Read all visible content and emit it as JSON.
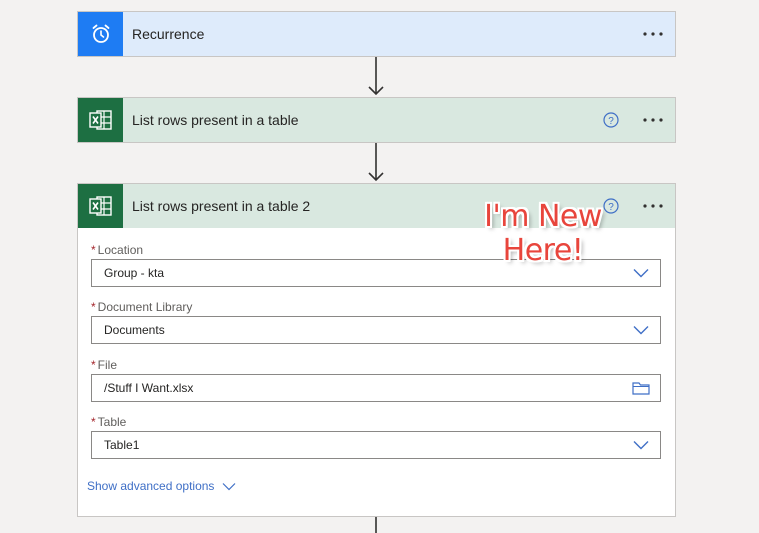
{
  "steps": [
    {
      "title": "Recurrence",
      "icon": "alarm-clock-icon"
    },
    {
      "title": "List rows present in a table",
      "icon": "excel-icon"
    },
    {
      "title": "List rows present in a table 2",
      "icon": "excel-icon"
    }
  ],
  "form": {
    "location": {
      "label": "Location",
      "value": "Group - kta"
    },
    "document_library": {
      "label": "Document Library",
      "value": "Documents"
    },
    "file": {
      "label": "File",
      "value": "/Stuff I Want.xlsx"
    },
    "table": {
      "label": "Table",
      "value": "Table1"
    },
    "required_mark": "*",
    "advanced_label": "Show advanced options"
  },
  "annotation": {
    "line1": "I'm New",
    "line2": "Here!"
  },
  "colors": {
    "recurrence_bg": "#deebfb",
    "recurrence_icon": "#1e7cf3",
    "excel_bg": "#d9e8e0",
    "excel_icon": "#1d6f42",
    "link": "#3f6fc6",
    "annotation": "#e8453c"
  }
}
